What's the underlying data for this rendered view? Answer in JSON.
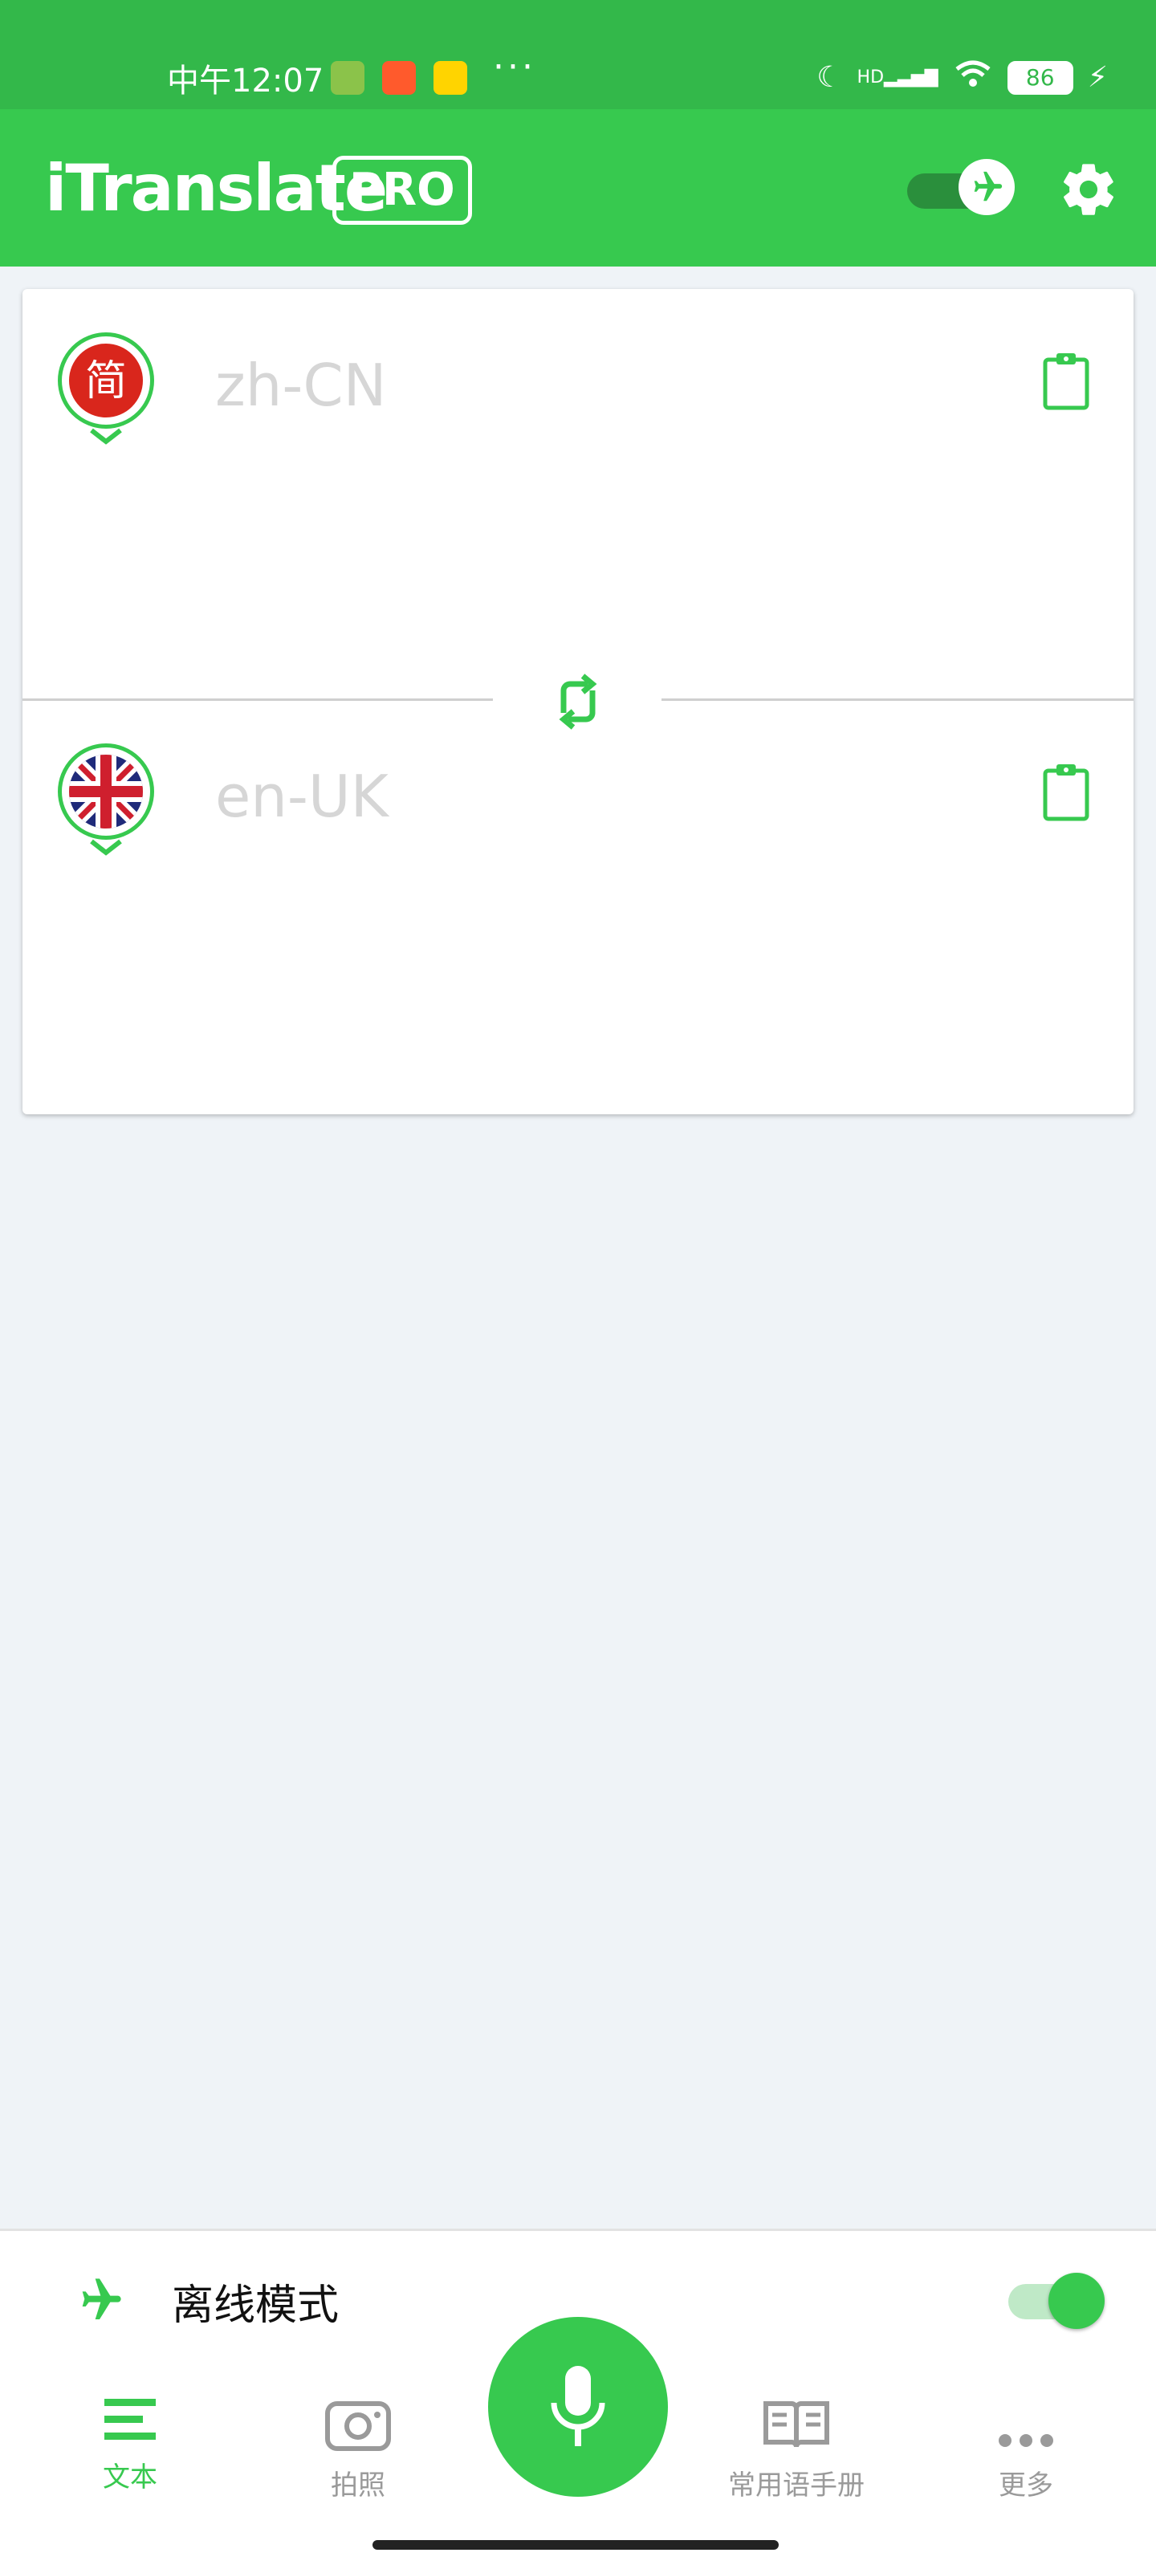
{
  "status_bar": {
    "time": "中午12:07",
    "dots": "···",
    "network": "HD",
    "battery": "86"
  },
  "app_bar": {
    "title": "iTranslate",
    "badge": "PRO"
  },
  "translation_card": {
    "source_language": "zh-CN",
    "source_flag_glyph": "简",
    "target_language": "en-UK"
  },
  "offline_mode": {
    "label": "离线模式",
    "enabled": true
  },
  "bottom_nav": {
    "items": [
      {
        "label": "文本",
        "icon": "text-lines-icon",
        "active": true
      },
      {
        "label": "拍照",
        "icon": "camera-icon",
        "active": false
      },
      {
        "label": "",
        "icon": "microphone-icon",
        "active": false
      },
      {
        "label": "常用语手册",
        "icon": "phrasebook-icon",
        "active": false
      },
      {
        "label": "更多",
        "icon": "more-dots-icon",
        "active": false
      }
    ]
  },
  "colors": {
    "status_bar": "#33b84a",
    "accent": "#37c94f",
    "background": "#eff3f7"
  }
}
